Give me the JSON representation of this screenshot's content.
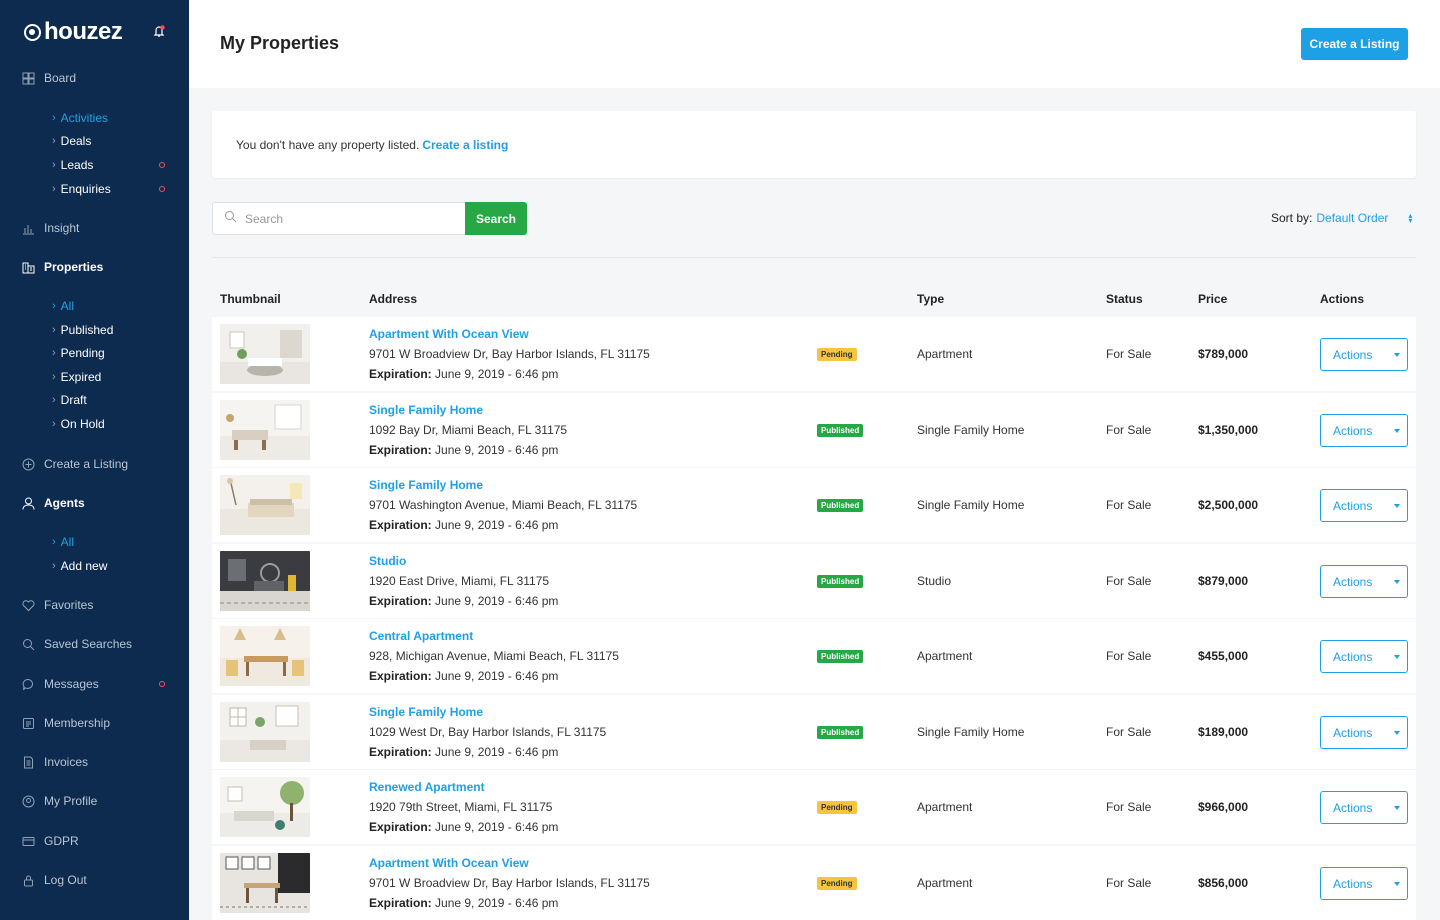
{
  "brand": {
    "name": "houzez"
  },
  "colors": {
    "sidebar": "#0d2b4e",
    "accent": "#1ea0e6",
    "success": "#28a745",
    "pending": "#f5c542",
    "alert_dot": "#ff4b55"
  },
  "sidebar": {
    "board": {
      "label": "Board",
      "icon": "board-icon"
    },
    "board_items": [
      {
        "label": "Activities",
        "current": true
      },
      {
        "label": "Deals"
      },
      {
        "label": "Leads",
        "dot": true
      },
      {
        "label": "Enquiries",
        "dot": true
      }
    ],
    "insight": {
      "label": "Insight",
      "icon": "chart-icon"
    },
    "properties": {
      "label": "Properties",
      "icon": "properties-icon"
    },
    "property_items": [
      {
        "label": "All",
        "current": true
      },
      {
        "label": "Published"
      },
      {
        "label": "Pending"
      },
      {
        "label": "Expired"
      },
      {
        "label": "Draft"
      },
      {
        "label": "On Hold"
      }
    ],
    "create_listing": {
      "label": "Create a Listing",
      "icon": "plus-circle-icon"
    },
    "agents": {
      "label": "Agents",
      "icon": "user-icon"
    },
    "agent_items": [
      {
        "label": "All",
        "current": true
      },
      {
        "label": "Add new"
      }
    ],
    "favorites": {
      "label": "Favorites",
      "icon": "heart-icon"
    },
    "saved_searches": {
      "label": "Saved Searches",
      "icon": "search-icon"
    },
    "messages": {
      "label": "Messages",
      "icon": "chat-icon",
      "dot": true
    },
    "membership": {
      "label": "Membership",
      "icon": "membership-icon"
    },
    "invoices": {
      "label": "Invoices",
      "icon": "invoice-icon"
    },
    "my_profile": {
      "label": "My Profile",
      "icon": "profile-icon"
    },
    "gdpr": {
      "label": "GDPR",
      "icon": "gdpr-icon"
    },
    "logout": {
      "label": "Log Out",
      "icon": "logout-icon"
    }
  },
  "header": {
    "title": "My Properties",
    "create_button": "Create a Listing"
  },
  "notice": {
    "text": "You don't have any property listed.",
    "link": "Create a listing"
  },
  "search": {
    "placeholder": "Search",
    "button": "Search"
  },
  "sort": {
    "label": "Sort by:",
    "value": "Default Order"
  },
  "table": {
    "columns": [
      "Thumbnail",
      "Address",
      "Type",
      "Status",
      "Price",
      "Actions"
    ],
    "expiration_label": "Expiration:",
    "action_label": "Actions",
    "rows": [
      {
        "title": "Apartment With Ocean View",
        "address": "9701 W Broadview Dr, Bay Harbor Islands, FL 31175",
        "expiration": "June 9, 2019 - 6:46 pm",
        "badge": "Pending",
        "type": "Apartment",
        "status": "For Sale",
        "price": "$789,000"
      },
      {
        "title": "Single Family Home",
        "address": "1092 Bay Dr, Miami Beach, FL 31175",
        "expiration": "June 9, 2019 - 6:46 pm",
        "badge": "Published",
        "type": "Single Family Home",
        "status": "For Sale",
        "price": "$1,350,000"
      },
      {
        "title": "Single Family Home",
        "address": "9701 Washington Avenue, Miami Beach, FL 31175",
        "expiration": "June 9, 2019 - 6:46 pm",
        "badge": "Published",
        "type": "Single Family Home",
        "status": "For Sale",
        "price": "$2,500,000"
      },
      {
        "title": "Studio",
        "address": "1920 East Drive, Miami, FL 31175",
        "expiration": "June 9, 2019 - 6:46 pm",
        "badge": "Published",
        "type": "Studio",
        "status": "For Sale",
        "price": "$879,000"
      },
      {
        "title": "Central Apartment",
        "address": "928, Michigan Avenue, Miami Beach, FL 31175",
        "expiration": "June 9, 2019 - 6:46 pm",
        "badge": "Published",
        "type": "Apartment",
        "status": "For Sale",
        "price": "$455,000"
      },
      {
        "title": "Single Family Home",
        "address": "1029 West Dr, Bay Harbor Islands, FL 31175",
        "expiration": "June 9, 2019 - 6:46 pm",
        "badge": "Published",
        "type": "Single Family Home",
        "status": "For Sale",
        "price": "$189,000"
      },
      {
        "title": "Renewed Apartment",
        "address": "1920 79th Street, Miami, FL 31175",
        "expiration": "June 9, 2019 - 6:46 pm",
        "badge": "Pending",
        "type": "Apartment",
        "status": "For Sale",
        "price": "$966,000"
      },
      {
        "title": "Apartment With Ocean View",
        "address": "9701 W Broadview Dr, Bay Harbor Islands, FL 31175",
        "expiration": "June 9, 2019 - 6:46 pm",
        "badge": "Pending",
        "type": "Apartment",
        "status": "For Sale",
        "price": "$856,000"
      }
    ]
  }
}
